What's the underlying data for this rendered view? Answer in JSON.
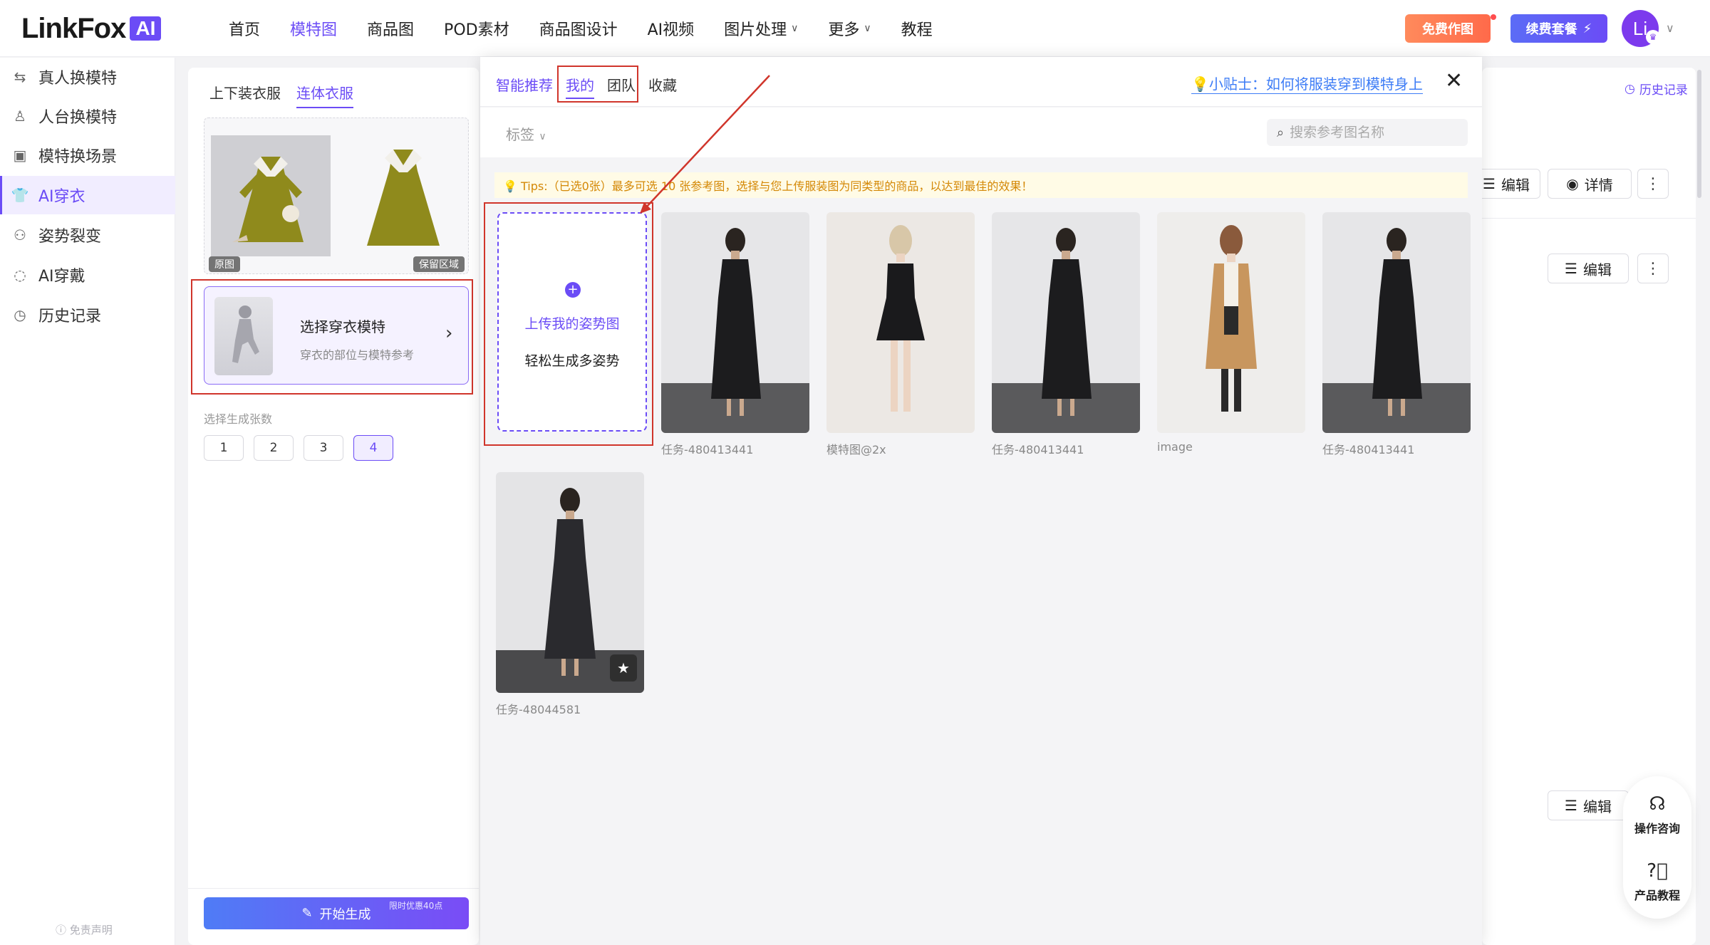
{
  "logo": {
    "text": "LinkFox",
    "badge": "AI"
  },
  "nav": [
    {
      "label": "首页"
    },
    {
      "label": "模特图",
      "active": true
    },
    {
      "label": "商品图"
    },
    {
      "label": "POD素材"
    },
    {
      "label": "商品图设计"
    },
    {
      "label": "AI视频"
    },
    {
      "label": "图片处理",
      "dropdown": true
    },
    {
      "label": "更多",
      "dropdown": true
    },
    {
      "label": "教程"
    }
  ],
  "header": {
    "free_btn": "免费作图",
    "renew_btn": "续费套餐",
    "avatar": "Li"
  },
  "sidebar": {
    "items": [
      {
        "label": "真人换模特",
        "icon": "swap-person-icon"
      },
      {
        "label": "人台换模特",
        "icon": "mannequin-icon"
      },
      {
        "label": "模特换场景",
        "icon": "scene-icon"
      },
      {
        "label": "AI穿衣",
        "icon": "tshirt-icon",
        "active": true
      },
      {
        "label": "姿势裂变",
        "icon": "pose-icon"
      },
      {
        "label": "AI穿戴",
        "icon": "accessory-icon"
      },
      {
        "label": "历史记录",
        "icon": "history-icon"
      }
    ],
    "disclaimer": "免责声明"
  },
  "config": {
    "tabs": [
      {
        "label": "上下装衣服"
      },
      {
        "label": "连体衣服",
        "active": true
      }
    ],
    "garment": {
      "original_label": "原图",
      "keep_label": "保留区域"
    },
    "model_select": {
      "title": "选择穿衣模特",
      "subtitle": "穿衣的部位与模特参考"
    },
    "count_label": "选择生成张数",
    "counts": [
      "1",
      "2",
      "3",
      "4"
    ],
    "selected_count": "4",
    "generate_btn": "开始生成",
    "promo": "限时优惠40点"
  },
  "background": {
    "history": "历史记录",
    "edit": "编辑",
    "detail": "详情"
  },
  "float_help": {
    "consult": "操作咨询",
    "tutorial": "产品教程"
  },
  "modal": {
    "tabs": [
      {
        "label": "智能推荐",
        "smart": true
      },
      {
        "label": "我的",
        "active": true
      },
      {
        "label": "团队"
      },
      {
        "label": "收藏"
      }
    ],
    "tip_link": "💡小贴士：如何将服装穿到模特身上",
    "tag_filter": "标签",
    "search_placeholder": "搜索参考图名称",
    "tips": "💡 Tips:（已选0张）最多可选 10 张参考图，选择与您上传服装图为同类型的商品，以达到最佳的效果！",
    "upload": {
      "title": "上传我的姿势图",
      "subtitle": "轻松生成多姿势"
    },
    "images": [
      {
        "name": "任务-480413441"
      },
      {
        "name": "模特图@2x"
      },
      {
        "name": "任务-480413441"
      },
      {
        "name": "image"
      },
      {
        "name": "任务-480413441"
      },
      {
        "name": "任务-48044581"
      }
    ]
  },
  "colors": {
    "accent": "#6b4cf6",
    "annotation": "#d0352b",
    "tips_bg": "#fffbe6",
    "tips_text": "#d48806"
  }
}
